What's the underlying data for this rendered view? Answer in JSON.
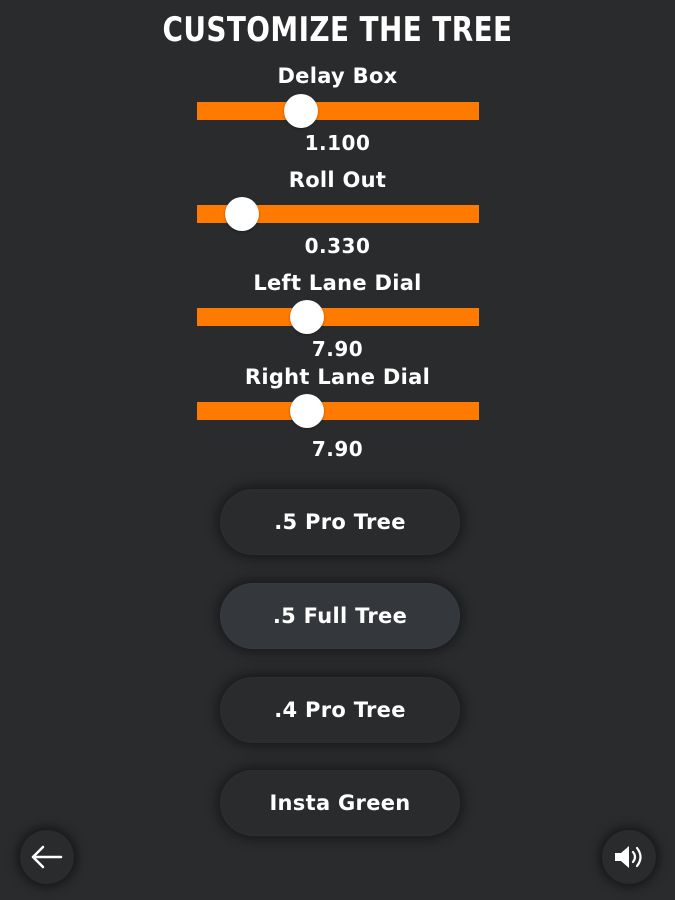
{
  "title": "CUSTOMIZE THE TREE",
  "accent_color": "#ff7a00",
  "sliders": [
    {
      "label": "Delay Box",
      "value": "1.100",
      "level": 0.37
    },
    {
      "label": "Roll Out",
      "value": "0.330",
      "level": 0.16
    },
    {
      "label": "Left Lane Dial",
      "value": "7.90",
      "level": 0.39
    },
    {
      "label": "Right Lane Dial",
      "value": "7.90",
      "level": 0.39
    }
  ],
  "presets": [
    {
      "label": ".5 Pro Tree",
      "selected": false
    },
    {
      "label": ".5 Full Tree",
      "selected": true
    },
    {
      "label": ".4 Pro Tree",
      "selected": false
    },
    {
      "label": "Insta Green",
      "selected": false
    }
  ],
  "footer": {
    "back_icon": "arrow-left-icon",
    "sound_icon": "speaker-volume-icon"
  }
}
